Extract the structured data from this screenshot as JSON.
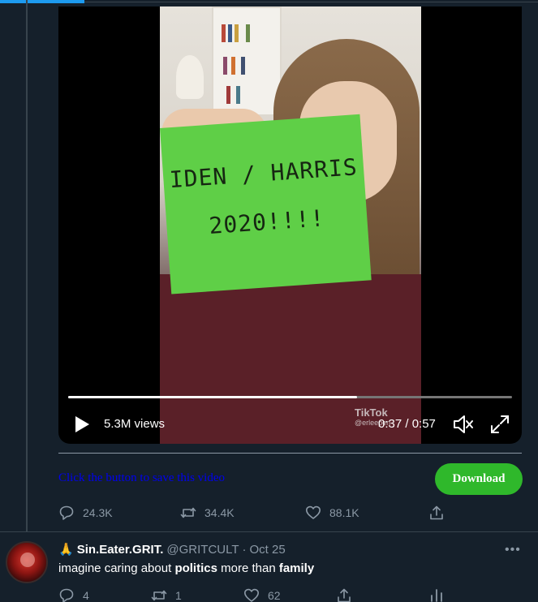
{
  "video": {
    "sign_line1": "IDEN / HARRIS",
    "sign_line2": "2020!!!!",
    "watermark": "TikTok",
    "watermark_user": "@erleepen",
    "views": "5.3M views",
    "time": "0:37 / 0:57",
    "progress": 0.65
  },
  "save_prompt": "Click the button to save this video",
  "download_label": "Download",
  "main_actions": {
    "replies": "24.3K",
    "retweets": "34.4K",
    "likes": "88.1K"
  },
  "reply": {
    "emoji": "🙏",
    "name": "Sin.Eater.GRIT.",
    "handle": "@GRITCULT",
    "separator": "·",
    "date": "Oct 25",
    "more": "•••",
    "text_parts": [
      "imagine caring about ",
      "politics",
      " more than ",
      "family"
    ],
    "replies": "4",
    "retweets": "1",
    "likes": "62"
  },
  "colors": {
    "background": "#15202b",
    "accent": "#1d9bf0",
    "download": "#2fb82b",
    "muted": "#8b98a5"
  }
}
